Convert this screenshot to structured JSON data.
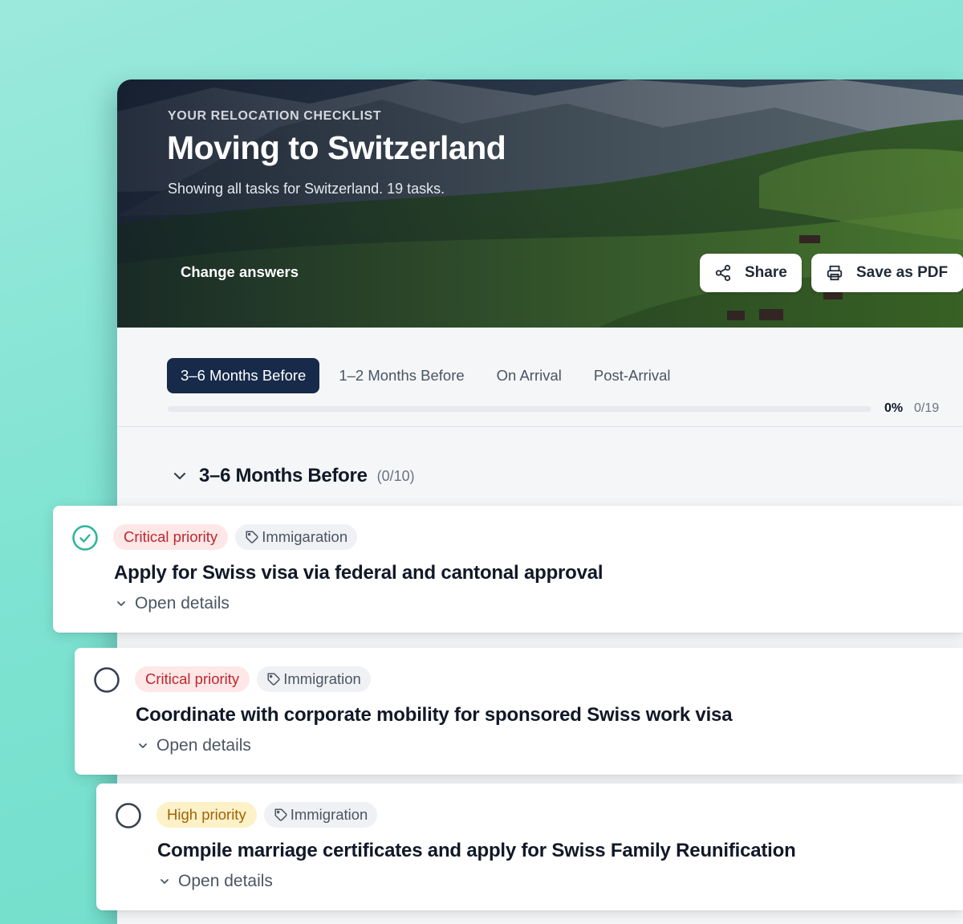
{
  "hero": {
    "eyebrow": "YOUR RELOCATION CHECKLIST",
    "title": "Moving to Switzerland",
    "subtitle": "Showing all tasks for Switzerland. 19 tasks.",
    "change_answers": "Change answers",
    "share_label": "Share",
    "pdf_label": "Save as PDF"
  },
  "tabs": [
    {
      "label": "3–6 Months Before",
      "active": true
    },
    {
      "label": "1–2 Months Before",
      "active": false
    },
    {
      "label": "On Arrival",
      "active": false
    },
    {
      "label": "Post-Arrival",
      "active": false
    }
  ],
  "progress": {
    "percent_label": "0%",
    "count_label": "0/19",
    "fraction": 0
  },
  "section": {
    "title": "3–6 Months Before",
    "count": "(0/10)"
  },
  "tasks": [
    {
      "priority": "Critical priority",
      "priority_level": "critical",
      "category": "Immigaration",
      "title": "Apply for Swiss visa via federal and cantonal approval",
      "details": "Open details",
      "checked": true
    },
    {
      "priority": "Critical priority",
      "priority_level": "critical",
      "category": "Immigration",
      "title": "Coordinate with corporate mobility for sponsored Swiss work visa",
      "details": "Open details",
      "checked": false
    },
    {
      "priority": "High priority",
      "priority_level": "high",
      "category": "Immigration",
      "title": "Compile marriage certificates and apply for Swiss Family Reunification",
      "details": "Open details",
      "checked": false
    }
  ],
  "colors": {
    "accent": "#2fb59c",
    "tab_active": "#172a4a",
    "critical_bg": "#fde7e7",
    "critical_text": "#c0272d",
    "high_bg": "#fdf1c7",
    "high_text": "#a16207"
  },
  "icons": [
    "share-icon",
    "printer-icon",
    "chevron-down-icon",
    "tag-icon",
    "check-circle-icon",
    "empty-circle-icon"
  ]
}
